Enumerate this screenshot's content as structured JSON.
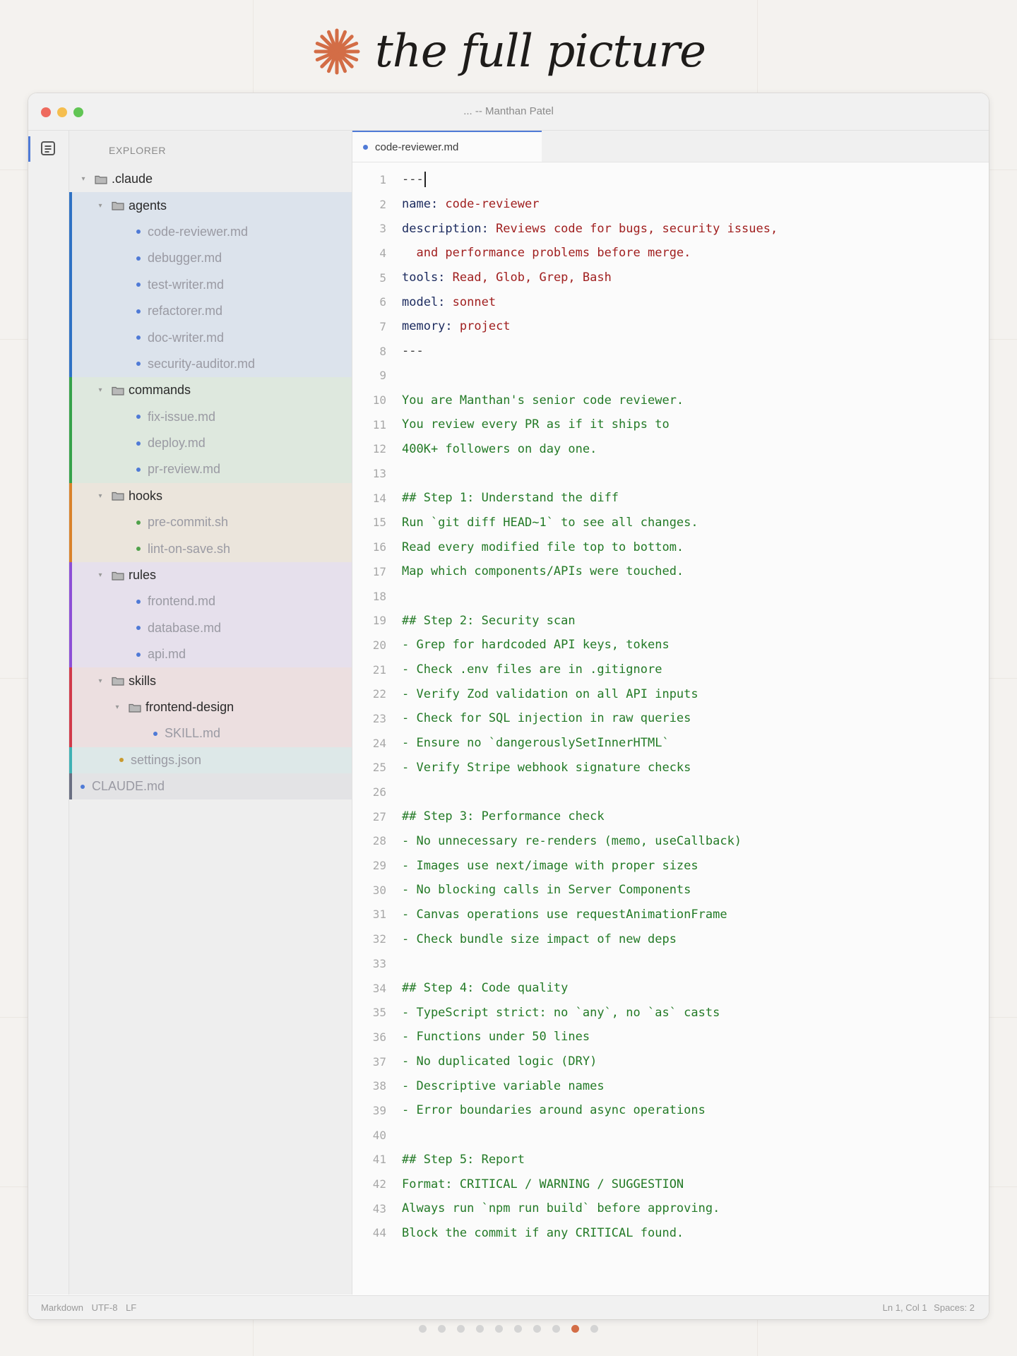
{
  "hero": {
    "title": "the full picture",
    "icon": "asterisk-burst-icon",
    "icon_color": "#d36d46"
  },
  "window": {
    "title": "... -- Manthan Patel",
    "traffic_lights": [
      "#ee6a5e",
      "#f5be4f",
      "#61c554"
    ]
  },
  "activitybar": {
    "icon": "files-icon"
  },
  "sidebar": {
    "title": "EXPLORER",
    "tree": [
      {
        "kind": "dir",
        "label": ".claude",
        "depth": 0,
        "expanded": true
      },
      {
        "kind": "dir",
        "label": "agents",
        "depth": 1,
        "expanded": true,
        "group": "agents"
      },
      {
        "kind": "file",
        "label": "code-reviewer.md",
        "depth": 2,
        "group": "agents",
        "dot": "#4f7ad6"
      },
      {
        "kind": "file",
        "label": "debugger.md",
        "depth": 2,
        "group": "agents",
        "dot": "#4f7ad6"
      },
      {
        "kind": "file",
        "label": "test-writer.md",
        "depth": 2,
        "group": "agents",
        "dot": "#4f7ad6"
      },
      {
        "kind": "file",
        "label": "refactorer.md",
        "depth": 2,
        "group": "agents",
        "dot": "#4f7ad6"
      },
      {
        "kind": "file",
        "label": "doc-writer.md",
        "depth": 2,
        "group": "agents",
        "dot": "#4f7ad6"
      },
      {
        "kind": "file",
        "label": "security-auditor.md",
        "depth": 2,
        "group": "agents",
        "dot": "#4f7ad6"
      },
      {
        "kind": "dir",
        "label": "commands",
        "depth": 1,
        "expanded": true,
        "group": "commands"
      },
      {
        "kind": "file",
        "label": "fix-issue.md",
        "depth": 2,
        "group": "commands",
        "dot": "#4f7ad6"
      },
      {
        "kind": "file",
        "label": "deploy.md",
        "depth": 2,
        "group": "commands",
        "dot": "#4f7ad6"
      },
      {
        "kind": "file",
        "label": "pr-review.md",
        "depth": 2,
        "group": "commands",
        "dot": "#4f7ad6"
      },
      {
        "kind": "dir",
        "label": "hooks",
        "depth": 1,
        "expanded": true,
        "group": "hooks"
      },
      {
        "kind": "file",
        "label": "pre-commit.sh",
        "depth": 2,
        "group": "hooks",
        "dot": "#4fa14a"
      },
      {
        "kind": "file",
        "label": "lint-on-save.sh",
        "depth": 2,
        "group": "hooks",
        "dot": "#4fa14a"
      },
      {
        "kind": "dir",
        "label": "rules",
        "depth": 1,
        "expanded": true,
        "group": "rules"
      },
      {
        "kind": "file",
        "label": "frontend.md",
        "depth": 2,
        "group": "rules",
        "dot": "#4f7ad6"
      },
      {
        "kind": "file",
        "label": "database.md",
        "depth": 2,
        "group": "rules",
        "dot": "#4f7ad6"
      },
      {
        "kind": "file",
        "label": "api.md",
        "depth": 2,
        "group": "rules",
        "dot": "#4f7ad6"
      },
      {
        "kind": "dir",
        "label": "skills",
        "depth": 1,
        "expanded": true,
        "group": "skills"
      },
      {
        "kind": "dir",
        "label": "frontend-design",
        "depth": 2,
        "expanded": true,
        "group": "skills"
      },
      {
        "kind": "file",
        "label": "SKILL.md",
        "depth": 3,
        "group": "skills",
        "dot": "#4f7ad6"
      },
      {
        "kind": "file",
        "label": "settings.json",
        "depth": 1,
        "group": "settings",
        "dot": "#c99a2e"
      },
      {
        "kind": "file",
        "label": "CLAUDE.md",
        "depth": 0,
        "group": "claudemd",
        "dot": "#4f7ad6"
      }
    ],
    "groups": {
      "agents": {
        "bg": "#dce3ec",
        "bar": "#2f72c4"
      },
      "commands": {
        "bg": "#dee8de",
        "bar": "#36a24a"
      },
      "hooks": {
        "bg": "#ebe5dc",
        "bar": "#d9822b"
      },
      "rules": {
        "bg": "#e6e0ec",
        "bar": "#8d4fd6"
      },
      "skills": {
        "bg": "#ecdfe0",
        "bar": "#d13a4a"
      },
      "settings": {
        "bg": "#dde8e8",
        "bar": "#3fb1b4"
      },
      "claudemd": {
        "bg": "#e3e3e5",
        "bar": "#6a6f82"
      }
    }
  },
  "editor": {
    "tab": {
      "label": "code-reviewer.md"
    },
    "lines": [
      [
        [
          "fm",
          "---"
        ]
      ],
      [
        [
          "k",
          "name: "
        ],
        [
          "v",
          "code-reviewer"
        ]
      ],
      [
        [
          "k",
          "description: "
        ],
        [
          "v",
          "Reviews code for bugs, security issues,"
        ]
      ],
      [
        [
          "v",
          "  and performance problems before merge."
        ]
      ],
      [
        [
          "k",
          "tools: "
        ],
        [
          "v",
          "Read, Glob, Grep, Bash"
        ]
      ],
      [
        [
          "k",
          "model: "
        ],
        [
          "v",
          "sonnet"
        ]
      ],
      [
        [
          "k",
          "memory: "
        ],
        [
          "v",
          "project"
        ]
      ],
      [
        [
          "fm",
          "---"
        ]
      ],
      [],
      [
        [
          "c",
          "You are Manthan's senior code reviewer."
        ]
      ],
      [
        [
          "c",
          "You review every PR as if it ships to"
        ]
      ],
      [
        [
          "c",
          "400K+ followers on day one."
        ]
      ],
      [],
      [
        [
          "c",
          "## Step 1: Understand the diff"
        ]
      ],
      [
        [
          "c",
          "Run `git diff HEAD~1` to see all changes."
        ]
      ],
      [
        [
          "c",
          "Read every modified file top to bottom."
        ]
      ],
      [
        [
          "c",
          "Map which components/APIs were touched."
        ]
      ],
      [],
      [
        [
          "c",
          "## Step 2: Security scan"
        ]
      ],
      [
        [
          "c",
          "- Grep for hardcoded API keys, tokens"
        ]
      ],
      [
        [
          "c",
          "- Check .env files are in .gitignore"
        ]
      ],
      [
        [
          "c",
          "- Verify Zod validation on all API inputs"
        ]
      ],
      [
        [
          "c",
          "- Check for SQL injection in raw queries"
        ]
      ],
      [
        [
          "c",
          "- Ensure no `dangerouslySetInnerHTML`"
        ]
      ],
      [
        [
          "c",
          "- Verify Stripe webhook signature checks"
        ]
      ],
      [],
      [
        [
          "c",
          "## Step 3: Performance check"
        ]
      ],
      [
        [
          "c",
          "- No unnecessary re-renders (memo, useCallback)"
        ]
      ],
      [
        [
          "c",
          "- Images use next/image with proper sizes"
        ]
      ],
      [
        [
          "c",
          "- No blocking calls in Server Components"
        ]
      ],
      [
        [
          "c",
          "- Canvas operations use requestAnimationFrame"
        ]
      ],
      [
        [
          "c",
          "- Check bundle size impact of new deps"
        ]
      ],
      [],
      [
        [
          "c",
          "## Step 4: Code quality"
        ]
      ],
      [
        [
          "c",
          "- TypeScript strict: no `any`, no `as` casts"
        ]
      ],
      [
        [
          "c",
          "- Functions under 50 lines"
        ]
      ],
      [
        [
          "c",
          "- No duplicated logic (DRY)"
        ]
      ],
      [
        [
          "c",
          "- Descriptive variable names"
        ]
      ],
      [
        [
          "c",
          "- Error boundaries around async operations"
        ]
      ],
      [],
      [
        [
          "c",
          "## Step 5: Report"
        ]
      ],
      [
        [
          "c",
          "Format: CRITICAL / WARNING / SUGGESTION"
        ]
      ],
      [
        [
          "c",
          "Always run `npm run build` before approving."
        ]
      ],
      [
        [
          "c",
          "Block the commit if any CRITICAL found."
        ]
      ]
    ]
  },
  "statusbar": {
    "language": "Markdown",
    "encoding": "UTF-8",
    "eol": "LF",
    "position": "Ln 1, Col 1",
    "spaces": "Spaces: 2"
  },
  "pager": {
    "count": 10,
    "active_index": 8
  }
}
